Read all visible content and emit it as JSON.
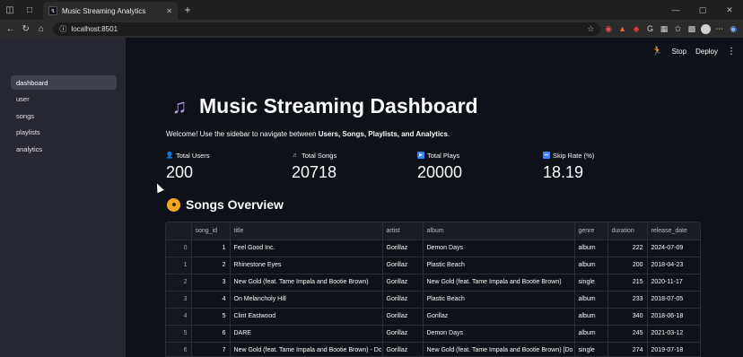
{
  "browser": {
    "tab_title": "Music Streaming Analytics",
    "url": "localhost:8501"
  },
  "header": {
    "stop_label": "Stop",
    "deploy_label": "Deploy"
  },
  "sidebar": {
    "items": [
      {
        "label": "dashboard",
        "active": true
      },
      {
        "label": "user",
        "active": false
      },
      {
        "label": "songs",
        "active": false
      },
      {
        "label": "playlists",
        "active": false
      },
      {
        "label": "analytics",
        "active": false
      }
    ]
  },
  "main": {
    "title": "Music Streaming Dashboard",
    "welcome_prefix": "Welcome! Use the sidebar to navigate between ",
    "welcome_bold": "Users, Songs, Playlists, and Analytics",
    "welcome_suffix": ".",
    "metrics": [
      {
        "label": "Total Users",
        "value": "200",
        "icon": "user-icon"
      },
      {
        "label": "Total Songs",
        "value": "20718",
        "icon": "music-notes-icon"
      },
      {
        "label": "Total Plays",
        "value": "20000",
        "icon": "play-icon"
      },
      {
        "label": "Skip Rate (%)",
        "value": "18.19",
        "icon": "skip-icon"
      }
    ],
    "section_title": "Songs Overview",
    "table": {
      "columns": [
        "",
        "song_id",
        "title",
        "artist",
        "album",
        "genre",
        "duration",
        "release_date"
      ],
      "rows": [
        [
          "0",
          "1",
          "Feel Good Inc.",
          "Gorillaz",
          "Demon Days",
          "album",
          "222",
          "2024-07-09"
        ],
        [
          "1",
          "2",
          "Rhinestone Eyes",
          "Gorillaz",
          "Plastic Beach",
          "album",
          "200",
          "2018-04-23"
        ],
        [
          "2",
          "3",
          "New Gold (feat. Tame Impala and Bootie Brown)",
          "Gorillaz",
          "New Gold (feat. Tame Impala and Bootie Brown)",
          "single",
          "215",
          "2020-11-17"
        ],
        [
          "3",
          "4",
          "On Melancholy Hill",
          "Gorillaz",
          "Plastic Beach",
          "album",
          "233",
          "2018-07-05"
        ],
        [
          "4",
          "5",
          "Clint Eastwood",
          "Gorillaz",
          "Gorillaz",
          "album",
          "340",
          "2018-06-18"
        ],
        [
          "5",
          "6",
          "DARE",
          "Gorillaz",
          "Demon Days",
          "album",
          "245",
          "2021-03-12"
        ],
        [
          "6",
          "7",
          "New Gold (feat. Tame Impala and Bootie Brown) - Dc",
          "Gorillaz",
          "New Gold (feat. Tame Impala and Bootie Brown) [Do",
          "single",
          "274",
          "2019-07-18"
        ]
      ]
    }
  }
}
